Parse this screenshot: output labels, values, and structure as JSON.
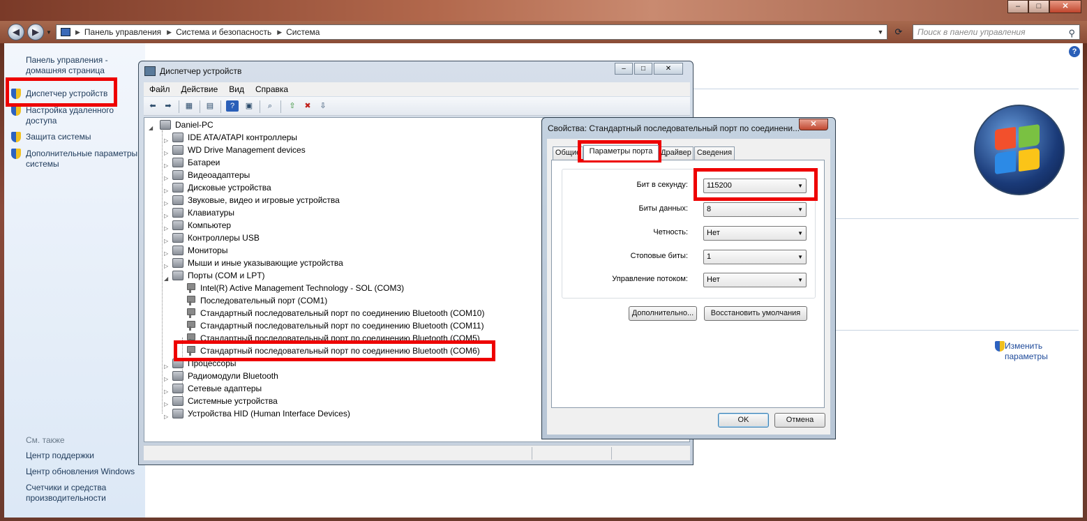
{
  "window_caption": {
    "minimize": "–",
    "maximize": "□",
    "close": "✕"
  },
  "address": {
    "segments": [
      "Панель управления",
      "Система и безопасность",
      "Система"
    ],
    "search_placeholder": "Поиск в панели управления"
  },
  "sidebar": {
    "home": "Панель управления - домашняя страница",
    "links": [
      "Диспетчер устройств",
      "Настройка удаленного доступа",
      "Защита системы",
      "Дополнительные параметры системы"
    ],
    "see_also_title": "См. также",
    "see_also": [
      "Центр поддержки",
      "Центр обновления Windows",
      "Счетчики и средства производительности"
    ]
  },
  "main": {
    "change_params": "Изменить параметры"
  },
  "device_manager": {
    "title": "Диспетчер устройств",
    "menu": [
      "Файл",
      "Действие",
      "Вид",
      "Справка"
    ],
    "root": "Daniel-PC",
    "categories_before": [
      "IDE ATA/ATAPI контроллеры",
      "WD Drive Management devices",
      "Батареи",
      "Видеоадаптеры",
      "Дисковые устройства",
      "Звуковые, видео и игровые устройства",
      "Клавиатуры",
      "Компьютер",
      "Контроллеры USB",
      "Мониторы",
      "Мыши и иные указывающие устройства",
      "Порты (COM и LPT)"
    ],
    "ports": [
      "Intel(R) Active Management Technology - SOL (COM3)",
      "Последовательный порт (COM1)",
      "Стандартный последовательный порт по соединению Bluetooth (COM10)",
      "Стандартный последовательный порт по соединению Bluetooth (COM11)",
      "Стандартный последовательный порт по соединению Bluetooth (COM5)",
      "Стандартный последовательный порт по соединению Bluetooth (COM6)"
    ],
    "categories_after": [
      "Процессоры",
      "Радиомодули Bluetooth",
      "Сетевые адаптеры",
      "Системные устройства",
      "Устройства HID (Human Interface Devices)"
    ]
  },
  "properties": {
    "title": "Свойства: Стандартный последовательный порт по соединени...",
    "tabs": [
      "Общие",
      "Параметры порта",
      "Драйвер",
      "Сведения"
    ],
    "fields": [
      {
        "label": "Бит в секунду:",
        "value": "115200"
      },
      {
        "label": "Биты данных:",
        "value": "8"
      },
      {
        "label": "Четность:",
        "value": "Нет"
      },
      {
        "label": "Стоповые биты:",
        "value": "1"
      },
      {
        "label": "Управление потоком:",
        "value": "Нет"
      }
    ],
    "advanced_button": "Дополнительно...",
    "restore_button": "Восстановить умолчания",
    "ok_button": "OK",
    "cancel_button": "Отмена"
  }
}
